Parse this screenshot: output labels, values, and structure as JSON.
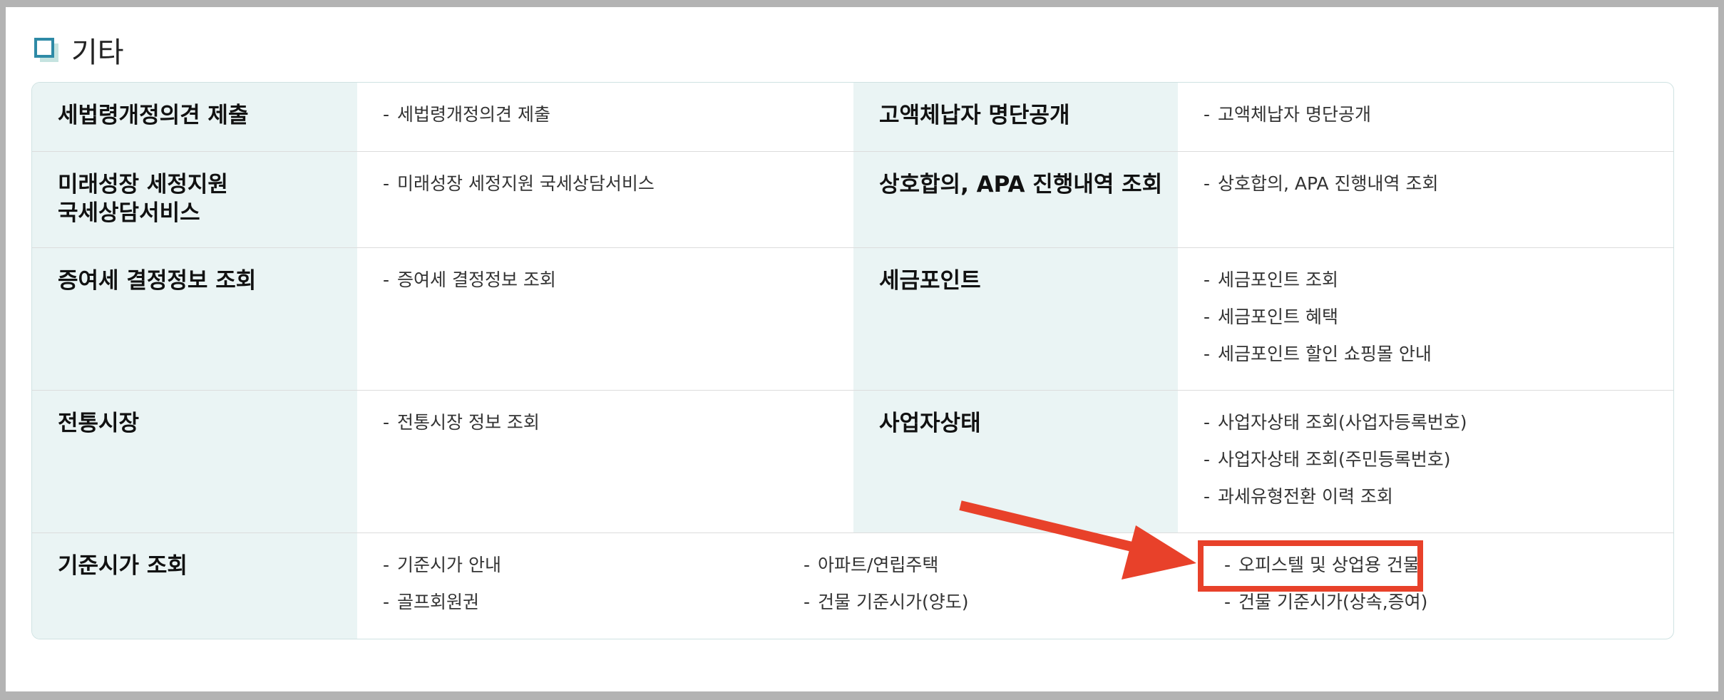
{
  "section": {
    "title": "기타"
  },
  "rows": [
    {
      "left": {
        "title": "세법령개정의견 제출",
        "items": [
          "세법령개정의견 제출"
        ]
      },
      "right": {
        "title": "고액체납자 명단공개",
        "items": [
          "고액체납자 명단공개"
        ]
      }
    },
    {
      "left": {
        "title_line1": "미래성장 세정지원",
        "title_line2": "국세상담서비스",
        "items": [
          "미래성장 세정지원 국세상담서비스"
        ]
      },
      "right": {
        "title": "상호합의, APA 진행내역 조회",
        "items": [
          "상호합의, APA 진행내역 조회"
        ]
      }
    },
    {
      "left": {
        "title": "증여세 결정정보 조회",
        "items": [
          "증여세 결정정보 조회"
        ]
      },
      "right": {
        "title": "세금포인트",
        "items": [
          "세금포인트 조회",
          "세금포인트 혜택",
          "세금포인트 할인 쇼핑몰 안내"
        ]
      }
    },
    {
      "left": {
        "title": "전통시장",
        "items": [
          "전통시장 정보 조회"
        ]
      },
      "right": {
        "title": "사업자상태",
        "items": [
          "사업자상태 조회(사업자등록번호)",
          "사업자상태 조회(주민등록번호)",
          "과세유형전환 이력 조회"
        ]
      }
    }
  ],
  "standard_price": {
    "title": "기준시가 조회",
    "col1": [
      "기준시가 안내",
      "골프회원권"
    ],
    "col2": [
      "아파트/연립주택",
      "건물 기준시가(양도)"
    ],
    "col3": [
      "오피스텔 및 상업용 건물",
      "건물 기준시가(상속,증여)"
    ]
  },
  "dash": "-",
  "colors": {
    "annotation": "#e8412a",
    "head_bg": "#eaf4f4",
    "icon": "#2e8aa6"
  }
}
